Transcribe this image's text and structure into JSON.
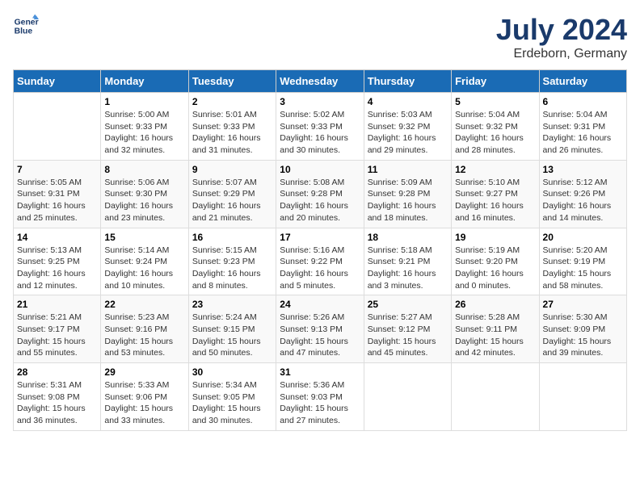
{
  "header": {
    "logo_line1": "General",
    "logo_line2": "Blue",
    "title": "July 2024",
    "subtitle": "Erdeborn, Germany"
  },
  "days_of_week": [
    "Sunday",
    "Monday",
    "Tuesday",
    "Wednesday",
    "Thursday",
    "Friday",
    "Saturday"
  ],
  "weeks": [
    [
      {
        "day": "",
        "sunrise": "",
        "sunset": "",
        "daylight": ""
      },
      {
        "day": "1",
        "sunrise": "Sunrise: 5:00 AM",
        "sunset": "Sunset: 9:33 PM",
        "daylight": "Daylight: 16 hours and 32 minutes."
      },
      {
        "day": "2",
        "sunrise": "Sunrise: 5:01 AM",
        "sunset": "Sunset: 9:33 PM",
        "daylight": "Daylight: 16 hours and 31 minutes."
      },
      {
        "day": "3",
        "sunrise": "Sunrise: 5:02 AM",
        "sunset": "Sunset: 9:33 PM",
        "daylight": "Daylight: 16 hours and 30 minutes."
      },
      {
        "day": "4",
        "sunrise": "Sunrise: 5:03 AM",
        "sunset": "Sunset: 9:32 PM",
        "daylight": "Daylight: 16 hours and 29 minutes."
      },
      {
        "day": "5",
        "sunrise": "Sunrise: 5:04 AM",
        "sunset": "Sunset: 9:32 PM",
        "daylight": "Daylight: 16 hours and 28 minutes."
      },
      {
        "day": "6",
        "sunrise": "Sunrise: 5:04 AM",
        "sunset": "Sunset: 9:31 PM",
        "daylight": "Daylight: 16 hours and 26 minutes."
      }
    ],
    [
      {
        "day": "7",
        "sunrise": "Sunrise: 5:05 AM",
        "sunset": "Sunset: 9:31 PM",
        "daylight": "Daylight: 16 hours and 25 minutes."
      },
      {
        "day": "8",
        "sunrise": "Sunrise: 5:06 AM",
        "sunset": "Sunset: 9:30 PM",
        "daylight": "Daylight: 16 hours and 23 minutes."
      },
      {
        "day": "9",
        "sunrise": "Sunrise: 5:07 AM",
        "sunset": "Sunset: 9:29 PM",
        "daylight": "Daylight: 16 hours and 21 minutes."
      },
      {
        "day": "10",
        "sunrise": "Sunrise: 5:08 AM",
        "sunset": "Sunset: 9:28 PM",
        "daylight": "Daylight: 16 hours and 20 minutes."
      },
      {
        "day": "11",
        "sunrise": "Sunrise: 5:09 AM",
        "sunset": "Sunset: 9:28 PM",
        "daylight": "Daylight: 16 hours and 18 minutes."
      },
      {
        "day": "12",
        "sunrise": "Sunrise: 5:10 AM",
        "sunset": "Sunset: 9:27 PM",
        "daylight": "Daylight: 16 hours and 16 minutes."
      },
      {
        "day": "13",
        "sunrise": "Sunrise: 5:12 AM",
        "sunset": "Sunset: 9:26 PM",
        "daylight": "Daylight: 16 hours and 14 minutes."
      }
    ],
    [
      {
        "day": "14",
        "sunrise": "Sunrise: 5:13 AM",
        "sunset": "Sunset: 9:25 PM",
        "daylight": "Daylight: 16 hours and 12 minutes."
      },
      {
        "day": "15",
        "sunrise": "Sunrise: 5:14 AM",
        "sunset": "Sunset: 9:24 PM",
        "daylight": "Daylight: 16 hours and 10 minutes."
      },
      {
        "day": "16",
        "sunrise": "Sunrise: 5:15 AM",
        "sunset": "Sunset: 9:23 PM",
        "daylight": "Daylight: 16 hours and 8 minutes."
      },
      {
        "day": "17",
        "sunrise": "Sunrise: 5:16 AM",
        "sunset": "Sunset: 9:22 PM",
        "daylight": "Daylight: 16 hours and 5 minutes."
      },
      {
        "day": "18",
        "sunrise": "Sunrise: 5:18 AM",
        "sunset": "Sunset: 9:21 PM",
        "daylight": "Daylight: 16 hours and 3 minutes."
      },
      {
        "day": "19",
        "sunrise": "Sunrise: 5:19 AM",
        "sunset": "Sunset: 9:20 PM",
        "daylight": "Daylight: 16 hours and 0 minutes."
      },
      {
        "day": "20",
        "sunrise": "Sunrise: 5:20 AM",
        "sunset": "Sunset: 9:19 PM",
        "daylight": "Daylight: 15 hours and 58 minutes."
      }
    ],
    [
      {
        "day": "21",
        "sunrise": "Sunrise: 5:21 AM",
        "sunset": "Sunset: 9:17 PM",
        "daylight": "Daylight: 15 hours and 55 minutes."
      },
      {
        "day": "22",
        "sunrise": "Sunrise: 5:23 AM",
        "sunset": "Sunset: 9:16 PM",
        "daylight": "Daylight: 15 hours and 53 minutes."
      },
      {
        "day": "23",
        "sunrise": "Sunrise: 5:24 AM",
        "sunset": "Sunset: 9:15 PM",
        "daylight": "Daylight: 15 hours and 50 minutes."
      },
      {
        "day": "24",
        "sunrise": "Sunrise: 5:26 AM",
        "sunset": "Sunset: 9:13 PM",
        "daylight": "Daylight: 15 hours and 47 minutes."
      },
      {
        "day": "25",
        "sunrise": "Sunrise: 5:27 AM",
        "sunset": "Sunset: 9:12 PM",
        "daylight": "Daylight: 15 hours and 45 minutes."
      },
      {
        "day": "26",
        "sunrise": "Sunrise: 5:28 AM",
        "sunset": "Sunset: 9:11 PM",
        "daylight": "Daylight: 15 hours and 42 minutes."
      },
      {
        "day": "27",
        "sunrise": "Sunrise: 5:30 AM",
        "sunset": "Sunset: 9:09 PM",
        "daylight": "Daylight: 15 hours and 39 minutes."
      }
    ],
    [
      {
        "day": "28",
        "sunrise": "Sunrise: 5:31 AM",
        "sunset": "Sunset: 9:08 PM",
        "daylight": "Daylight: 15 hours and 36 minutes."
      },
      {
        "day": "29",
        "sunrise": "Sunrise: 5:33 AM",
        "sunset": "Sunset: 9:06 PM",
        "daylight": "Daylight: 15 hours and 33 minutes."
      },
      {
        "day": "30",
        "sunrise": "Sunrise: 5:34 AM",
        "sunset": "Sunset: 9:05 PM",
        "daylight": "Daylight: 15 hours and 30 minutes."
      },
      {
        "day": "31",
        "sunrise": "Sunrise: 5:36 AM",
        "sunset": "Sunset: 9:03 PM",
        "daylight": "Daylight: 15 hours and 27 minutes."
      },
      {
        "day": "",
        "sunrise": "",
        "sunset": "",
        "daylight": ""
      },
      {
        "day": "",
        "sunrise": "",
        "sunset": "",
        "daylight": ""
      },
      {
        "day": "",
        "sunrise": "",
        "sunset": "",
        "daylight": ""
      }
    ]
  ]
}
